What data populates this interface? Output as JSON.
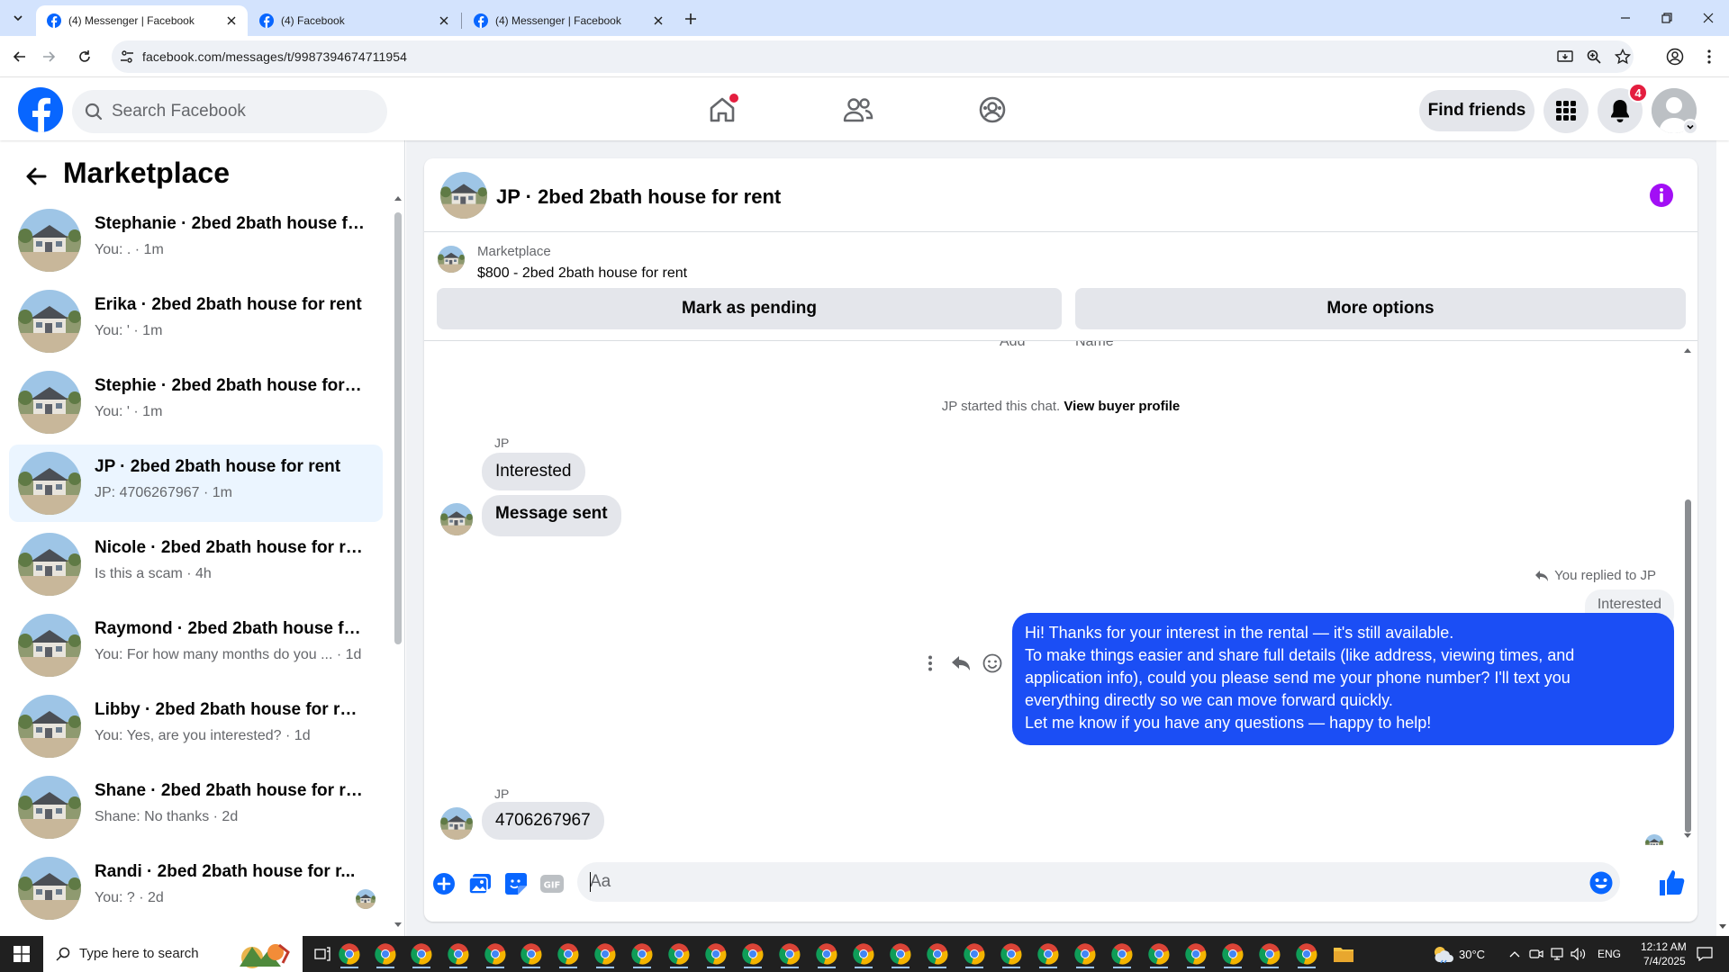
{
  "browser": {
    "tabs": [
      {
        "title": "(4) Messenger | Facebook",
        "active": true
      },
      {
        "title": "(4) Facebook",
        "active": false
      },
      {
        "title": "(4) Messenger | Facebook",
        "active": false
      }
    ],
    "url": "facebook.com/messages/t/9987394674711954"
  },
  "fb": {
    "search_placeholder": "Search Facebook",
    "find_friends": "Find friends",
    "notification_count": "4",
    "brand_color": "#0866ff"
  },
  "sidebar": {
    "title": "Marketplace",
    "conversations": [
      {
        "name": "Stephanie · 2bed 2bath house fo...",
        "preview": "You: . · 1m",
        "active": false
      },
      {
        "name": "Erika · 2bed 2bath house for rent",
        "preview": "You: ' · 1m",
        "active": false
      },
      {
        "name": "Stephie · 2bed 2bath house for r...",
        "preview": "You: ' · 1m",
        "active": false
      },
      {
        "name": "JP · 2bed 2bath house for rent",
        "preview": "JP: 4706267967 · 1m",
        "active": true
      },
      {
        "name": "Nicole · 2bed 2bath house for rent",
        "preview": "Is this a scam · 4h",
        "active": false
      },
      {
        "name": "Raymond · 2bed 2bath house for...",
        "preview": "You: For how many months do you ... · 1d",
        "active": false
      },
      {
        "name": "Libby · 2bed 2bath house for rent",
        "preview": "You: Yes, are you interested? · 1d",
        "active": false
      },
      {
        "name": "Shane · 2bed 2bath house for rent",
        "preview": "Shane: No thanks · 2d",
        "active": false
      },
      {
        "name": "Randi · 2bed 2bath house for r...",
        "preview": "You: ? · 2d",
        "active": false
      }
    ]
  },
  "chat": {
    "title": "JP · 2bed 2bath house for rent",
    "listing_label": "Marketplace",
    "listing_price": "$800 - 2bed 2bath house for rent",
    "mark_pending": "Mark as pending",
    "more_options": "More options",
    "cut_left": "Add",
    "cut_right": "Name",
    "started_text": "JP started this chat.",
    "view_profile": "View buyer profile",
    "sender": "JP",
    "msg_interested": "Interested",
    "msg_sent": "Message sent",
    "replied_to": "You replied to JP",
    "quoted": "Interested",
    "reply_lines": [
      "Hi! Thanks for your interest in the rental — it's still available.",
      "To make things easier and share full details (like address, viewing times, and",
      "application info), could you please send me your phone number? I'll text you",
      "everything directly so we can move forward quickly.",
      "Let me know if you have any questions — happy to help!"
    ],
    "last_msg": "4706267967",
    "composer_placeholder": "Aa",
    "accent": "#1b4ef5"
  },
  "taskbar": {
    "search_placeholder": "Type here to search",
    "temperature": "30°C",
    "language": "ENG",
    "time": "12:12 AM",
    "date": "7/4/2025"
  }
}
